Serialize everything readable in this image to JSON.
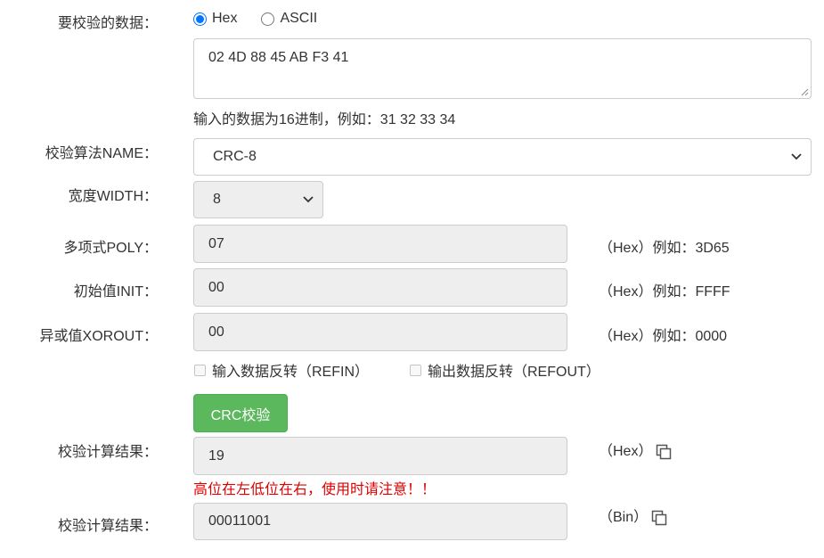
{
  "data_label": "要校验的数据：",
  "format_options": {
    "hex": "Hex",
    "ascii": "ASCII",
    "selected": "hex"
  },
  "data_input": {
    "value": "02 4D 88 45 AB F3 41"
  },
  "data_hint": "输入的数据为16进制，例如：31 32 33 34",
  "algorithm": {
    "label": "校验算法NAME：",
    "value": "CRC-8"
  },
  "width": {
    "label": "宽度WIDTH：",
    "value": "8"
  },
  "poly": {
    "label": "多项式POLY：",
    "value": "07",
    "hint": "（Hex）例如：3D65"
  },
  "init": {
    "label": "初始值INIT：",
    "value": "00",
    "hint": "（Hex）例如：FFFF"
  },
  "xorout": {
    "label": "异或值XOROUT：",
    "value": "00",
    "hint": "（Hex）例如：0000"
  },
  "refin": {
    "label": "输入数据反转（REFIN）",
    "checked": false
  },
  "refout": {
    "label": "输出数据反转（REFOUT）",
    "checked": false
  },
  "submit_label": "CRC校验",
  "result_hex": {
    "label": "校验计算结果：",
    "value": "19",
    "unit": "（Hex）",
    "copy_icon": "copy-icon"
  },
  "warning": "高位在左低位在右，使用时请注意！！",
  "result_bin": {
    "label": "校验计算结果：",
    "value": "00011001",
    "unit": "（Bin）",
    "copy_icon": "copy-icon"
  },
  "colors": {
    "accent": "#0075ff",
    "button": "#5cb85c",
    "warning": "#e00000",
    "readonly_bg": "#eeeeee"
  }
}
